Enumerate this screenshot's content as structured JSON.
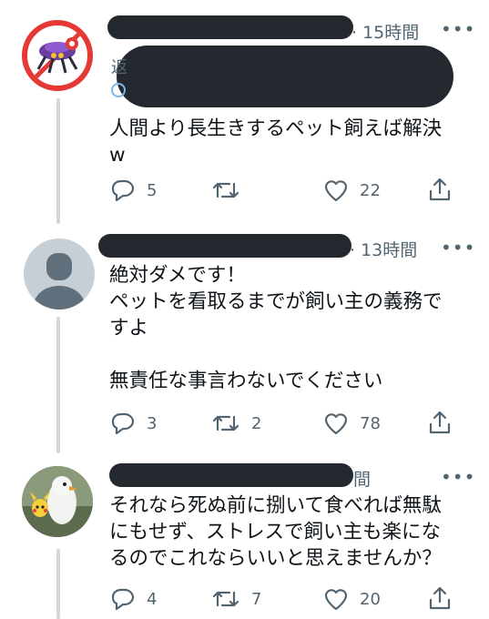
{
  "tweets": [
    {
      "time": "· 15時間",
      "text": "人間より長生きするペット飼えば解決\nw",
      "replies": "5",
      "retweets": "",
      "likes": "22"
    },
    {
      "time": "· 13時間",
      "text": "絶対ダメです！\nペットを看取るまでが飼い主の義務で\nすよ\n\n無責任な事言わないでください",
      "replies": "3",
      "retweets": "2",
      "likes": "78"
    },
    {
      "time": "間",
      "text": "それなら死ぬ前に捌いて食べれば無駄\nにもせず、ストレスで飼い主も楽にな\nるのでこれならいいと思えませんか？",
      "replies": "4",
      "retweets": "7",
      "likes": "20"
    }
  ],
  "more_label": "•••",
  "icons": [
    "reply-icon",
    "retweet-icon",
    "like-icon",
    "share-icon",
    "more-icon"
  ],
  "colors": {
    "text": "#0f1419",
    "muted": "#536471",
    "thread": "#cfd9de",
    "redact": "#24292f"
  }
}
